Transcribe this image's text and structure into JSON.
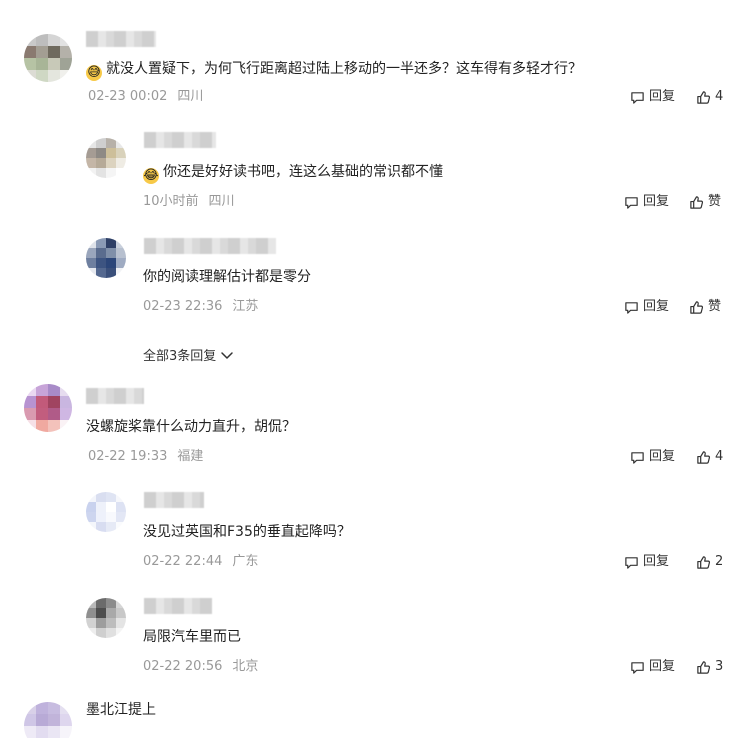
{
  "labels": {
    "reply": "回复",
    "like": "赞"
  },
  "comments": [
    {
      "text": "就没人置疑下，为何飞行距离超过陆上移动的一半还多？这车得有多轻才行？",
      "time": "02-23 00:02",
      "location": "四川",
      "likes": "4"
    },
    {
      "text": "你还是好好读书吧，连这么基础的常识都不懂",
      "time": "10小时前",
      "location": "四川",
      "likes": "赞"
    },
    {
      "text": "你的阅读理解估计都是零分",
      "time": "02-23 22:36",
      "location": "江苏",
      "likes": "赞"
    },
    {
      "text": "没螺旋桨靠什么动力直升，胡侃？",
      "time": "02-22 19:33",
      "location": "福建",
      "likes": "4"
    },
    {
      "text": "没见过英国和F35的垂直起降吗？",
      "time": "02-22 22:44",
      "location": "广东",
      "likes": "2"
    },
    {
      "text": "局限汽车里而已",
      "time": "02-22 20:56",
      "location": "北京",
      "likes": "3"
    }
  ],
  "more_replies": "全部3条回复",
  "partial_name": "墨北江提上"
}
